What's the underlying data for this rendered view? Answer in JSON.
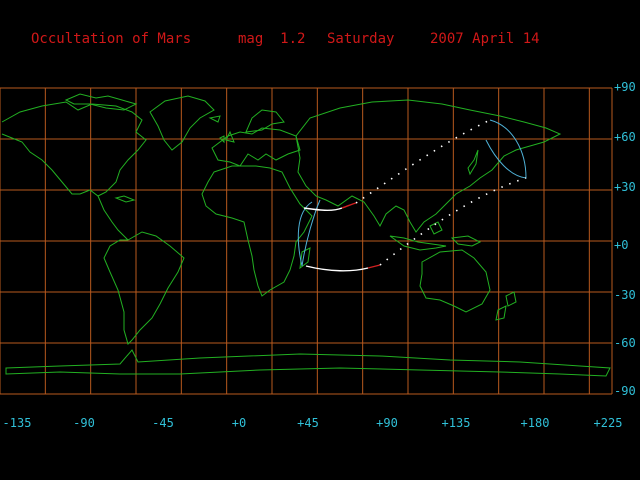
{
  "header": {
    "event": "Occultation of Mars",
    "magnitude": "mag  1.2",
    "weekday": "Saturday",
    "date": "2007 April 14"
  },
  "map": {
    "lon_range": [
      -180,
      225
    ],
    "lat_range": [
      -90,
      90
    ],
    "grid_step_lon": 30,
    "grid_step_lat": 30,
    "lat_labels": [
      "+90",
      "+60",
      "+30",
      "+0",
      "-30",
      "-60",
      "-90"
    ],
    "lon_labels": [
      "-135",
      "-90",
      "-45",
      "+0",
      "+45",
      "+90",
      "+135",
      "+180",
      "+225"
    ],
    "colors": {
      "background": "#000000",
      "grid": "#b85a1e",
      "coastline": "#22b022",
      "title": "#d01818",
      "axis_labels": "#30c0d8",
      "limit_curve": "#4fb2d8",
      "visibility_track": "#ffffff",
      "daylight_track": "#d02020"
    }
  }
}
